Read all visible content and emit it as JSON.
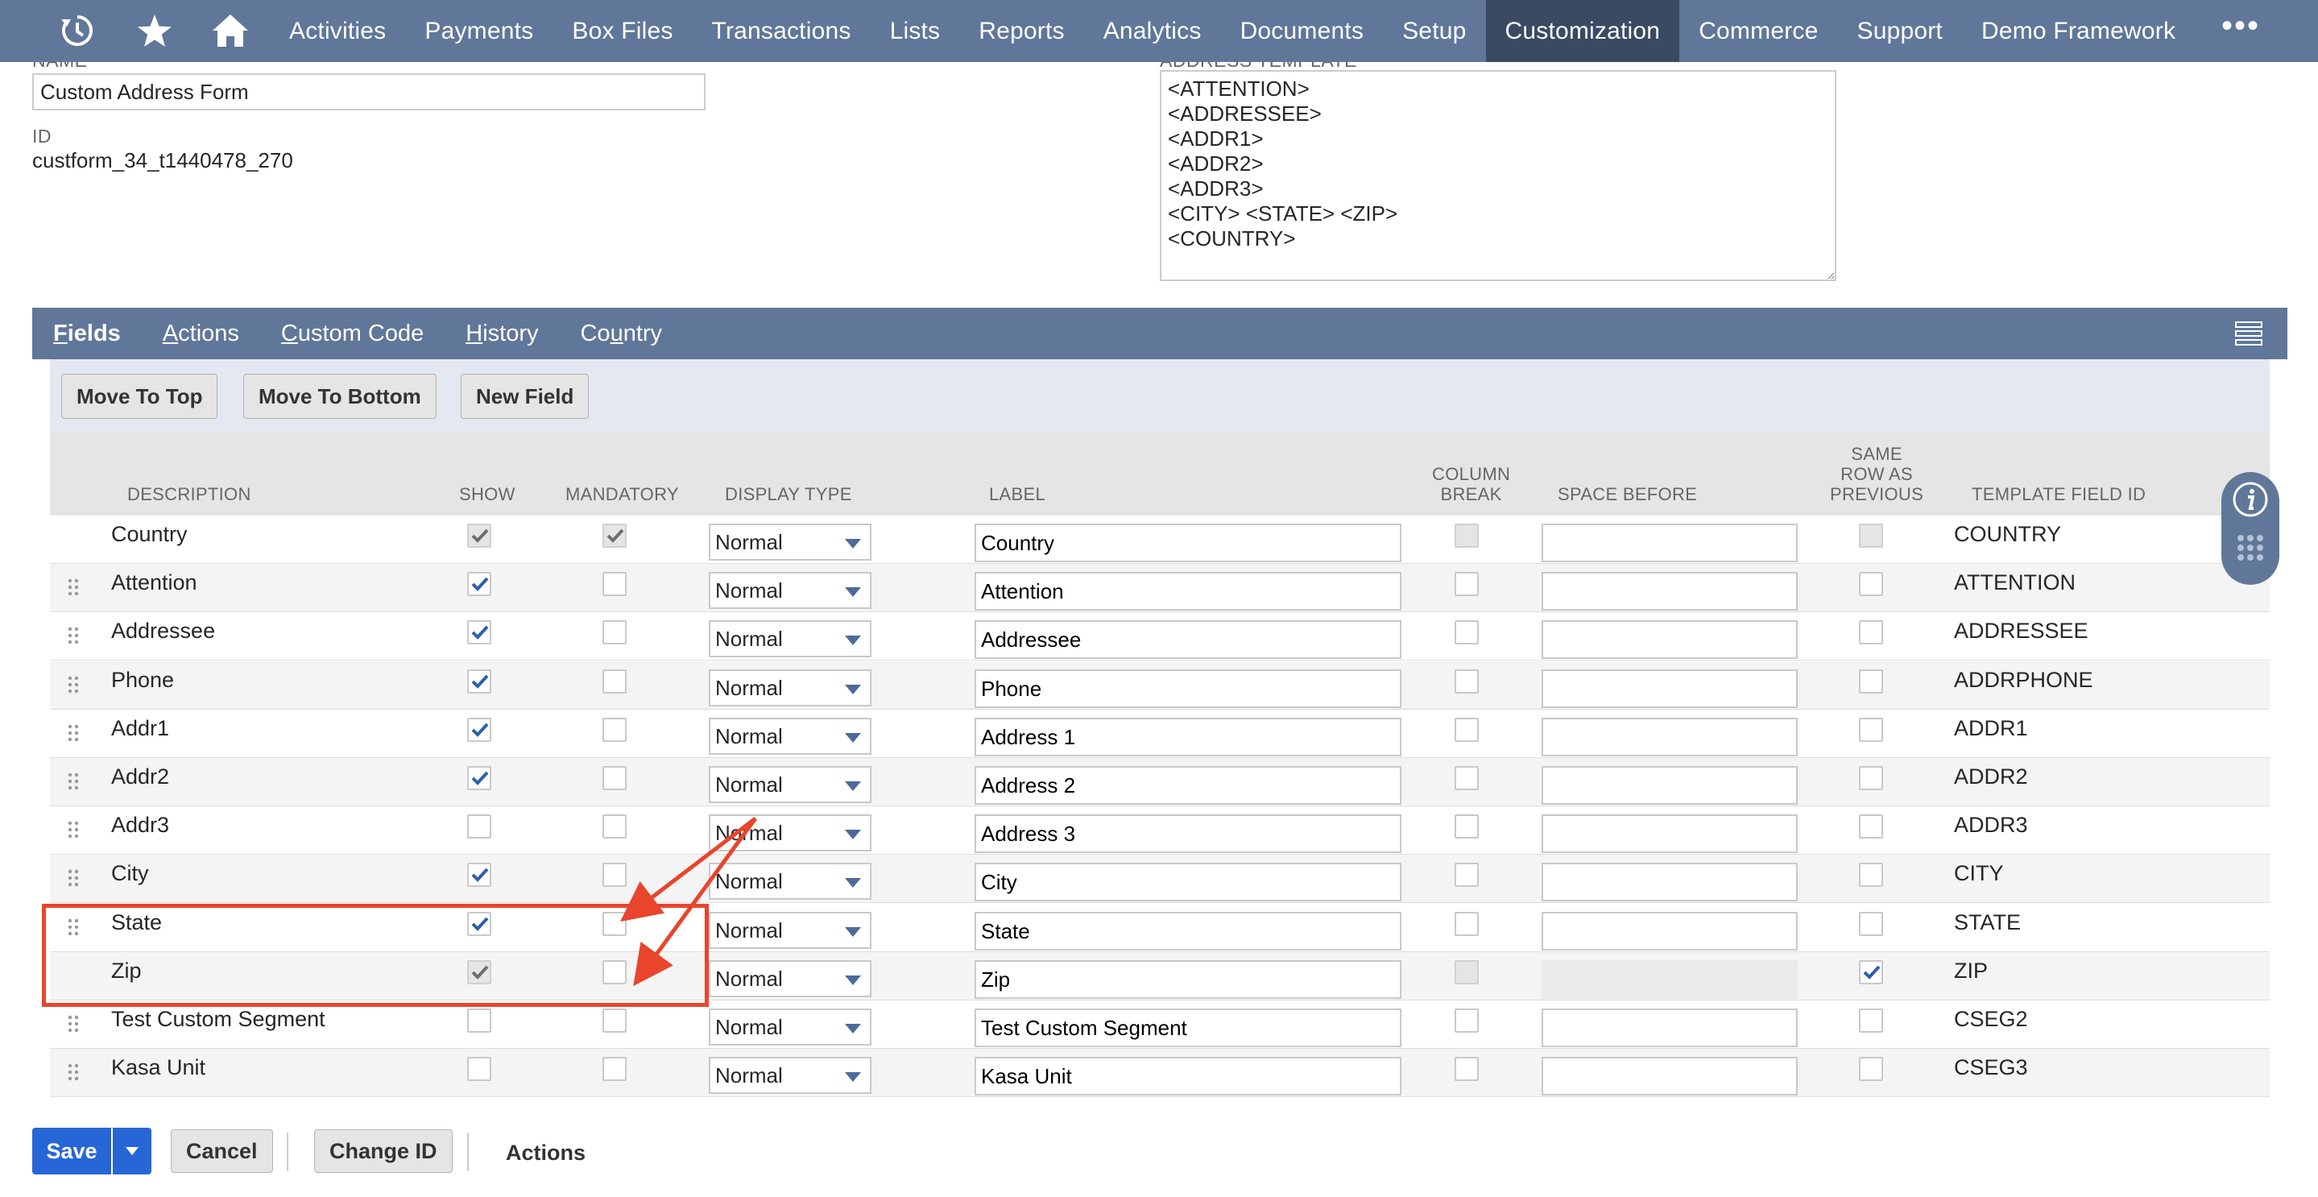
{
  "nav": {
    "menu": [
      "Activities",
      "Payments",
      "Box Files",
      "Transactions",
      "Lists",
      "Reports",
      "Analytics",
      "Documents",
      "Setup",
      "Customization",
      "Commerce",
      "Support",
      "Demo Framework"
    ],
    "active": "Customization",
    "more": "•••"
  },
  "form": {
    "name_label": "NAME",
    "name_value": "Custom Address Form",
    "id_label": "ID",
    "id_value": "custform_34_t1440478_270",
    "address_template_label": "ADDRESS TEMPLATE",
    "address_template": "<ATTENTION>\n<ADDRESSEE>\n<ADDR1>\n<ADDR2>\n<ADDR3>\n<CITY> <STATE> <ZIP>\n<COUNTRY>"
  },
  "subtabs": [
    {
      "u": "F",
      "rest": "ields"
    },
    {
      "u": "A",
      "rest": "ctions"
    },
    {
      "u": "C",
      "rest": "ustom Code"
    },
    {
      "u": "H",
      "rest": "istory"
    },
    {
      "pre": "Co",
      "u": "u",
      "rest": "ntry"
    }
  ],
  "buttons": {
    "move_top": "Move To Top",
    "move_bottom": "Move To Bottom",
    "new_field": "New Field"
  },
  "columns": {
    "description": "DESCRIPTION",
    "show": "SHOW",
    "mandatory": "MANDATORY",
    "display_type": "DISPLAY TYPE",
    "label": "LABEL",
    "column_break": "COLUMN\nBREAK",
    "space_before": "SPACE BEFORE",
    "same_row": "SAME\nROW AS\nPREVIOUS",
    "template_field_id": "TEMPLATE FIELD ID"
  },
  "rows": [
    {
      "description": "Country",
      "show": true,
      "show_disabled": true,
      "mandatory": true,
      "mandatory_disabled": true,
      "display_type": "Normal",
      "label": "Country",
      "column_break": false,
      "column_break_disabled": true,
      "space_disabled": false,
      "same_row": false,
      "same_row_disabled": true,
      "template_field_id": "COUNTRY",
      "drag": false
    },
    {
      "description": "Attention",
      "show": true,
      "mandatory": false,
      "display_type": "Normal",
      "label": "Attention",
      "template_field_id": "ATTENTION",
      "drag": true
    },
    {
      "description": "Addressee",
      "show": true,
      "mandatory": false,
      "display_type": "Normal",
      "label": "Addressee",
      "template_field_id": "ADDRESSEE",
      "drag": true
    },
    {
      "description": "Phone",
      "show": true,
      "mandatory": false,
      "display_type": "Normal",
      "label": "Phone",
      "template_field_id": "ADDRPHONE",
      "drag": true
    },
    {
      "description": "Addr1",
      "show": true,
      "mandatory": false,
      "display_type": "Normal",
      "label": "Address 1",
      "template_field_id": "ADDR1",
      "drag": true
    },
    {
      "description": "Addr2",
      "show": true,
      "mandatory": false,
      "display_type": "Normal",
      "label": "Address 2",
      "template_field_id": "ADDR2",
      "drag": true
    },
    {
      "description": "Addr3",
      "show": false,
      "mandatory": false,
      "display_type": "Normal",
      "label": "Address 3",
      "template_field_id": "ADDR3",
      "drag": true
    },
    {
      "description": "City",
      "show": true,
      "mandatory": false,
      "display_type": "Normal",
      "label": "City",
      "template_field_id": "CITY",
      "drag": true
    },
    {
      "description": "State",
      "show": true,
      "mandatory": false,
      "display_type": "Normal",
      "label": "State",
      "template_field_id": "STATE",
      "drag": true
    },
    {
      "description": "Zip",
      "show": true,
      "show_disabled": true,
      "mandatory": false,
      "display_type": "Normal",
      "label": "Zip",
      "column_break": false,
      "column_break_disabled": true,
      "space_disabled": true,
      "same_row": true,
      "template_field_id": "ZIP",
      "drag": false
    },
    {
      "description": "Test Custom Segment",
      "show": false,
      "mandatory": false,
      "display_type": "Normal",
      "label": "Test Custom Segment",
      "template_field_id": "CSEG2",
      "drag": true
    },
    {
      "description": "Kasa Unit",
      "show": false,
      "mandatory": false,
      "display_type": "Normal",
      "label": "Kasa Unit",
      "template_field_id": "CSEG3",
      "drag": true
    }
  ],
  "footer": {
    "save": "Save",
    "cancel": "Cancel",
    "change_id": "Change ID",
    "actions": "Actions"
  },
  "colors": {
    "nav_bg": "#607799",
    "nav_active": "#3b4a63",
    "primary_button": "#2766d6",
    "annotation": "#e8452c",
    "checkmark": "#2f5fa8"
  }
}
